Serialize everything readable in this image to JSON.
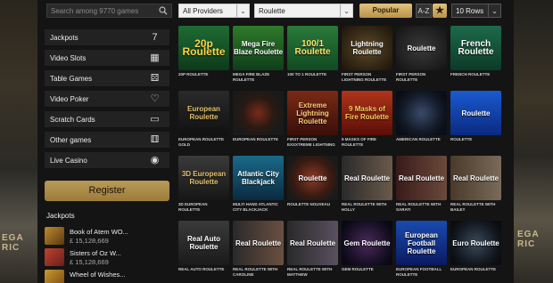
{
  "search": {
    "placeholder": "Search among 9770 games"
  },
  "filters": {
    "providers": "All Providers",
    "category": "Roulette",
    "popular_label": "Popular",
    "az_label": "A-Z",
    "rows_label": "10 Rows"
  },
  "sidebar": {
    "items": [
      {
        "label": "Jackpots",
        "icon": "seven-icon"
      },
      {
        "label": "Video Slots",
        "icon": "slot-machine-icon"
      },
      {
        "label": "Table Games",
        "icon": "dice-icon"
      },
      {
        "label": "Video Poker",
        "icon": "card-icon"
      },
      {
        "label": "Scratch Cards",
        "icon": "scratch-card-icon"
      },
      {
        "label": "Other games",
        "icon": "dice-icon"
      },
      {
        "label": "Live Casino",
        "icon": "chips-icon"
      }
    ],
    "register_label": "Register",
    "jackpots_title": "Jackpots",
    "jackpots": [
      {
        "name": "Book of Atem WO...",
        "amount": "£ 15,128,669"
      },
      {
        "name": "Sisters of Oz W...",
        "amount": "£ 15,128,669"
      },
      {
        "name": "Wheel of Wishes...",
        "amount": ""
      }
    ]
  },
  "games": [
    {
      "art": "20p Roulette",
      "caption": "20P ROULETTE"
    },
    {
      "art": "Mega Fire Blaze Roulette",
      "caption": "MEGA FIRE BLAZE ROULETTE"
    },
    {
      "art": "100/1 Roulette",
      "caption": "100 TO 1 ROULETTE"
    },
    {
      "art": "Lightning Roulette",
      "caption": "FIRST PERSON LIGHTNING ROULETTE"
    },
    {
      "art": "Roulette",
      "caption": "FIRST PERSON ROULETTE"
    },
    {
      "art": "French Roulette",
      "caption": "FRENCH ROULETTE"
    },
    {
      "art": "European Roulette",
      "caption": "EUROPEAN ROULETTE GOLD"
    },
    {
      "art": "",
      "caption": "EUROPEAN ROULETTE"
    },
    {
      "art": "Extreme Lightning Roulette",
      "caption": "FIRST PERSON EXXXTREME LIGHTNING ROULETTE"
    },
    {
      "art": "9 Masks of Fire Roulette",
      "caption": "9 MASKS OF FIRE ROULETTE"
    },
    {
      "art": "",
      "caption": "AMERICAN ROULETTE"
    },
    {
      "art": "Roulette",
      "caption": "ROULETTE"
    },
    {
      "art": "3D European Roulette",
      "caption": "3D EUROPEAN ROULETTE"
    },
    {
      "art": "Atlantic City Blackjack",
      "caption": "MULTI HAND ATLANTIC CITY BLACKJACK"
    },
    {
      "art": "Roulette",
      "caption": "ROULETTE NOUVEAU"
    },
    {
      "art": "Real Roulette",
      "caption": "REAL ROULETTE WITH HOLLY"
    },
    {
      "art": "Real Roulette",
      "caption": "REAL ROULETTE WITH SARATI"
    },
    {
      "art": "Real Roulette",
      "caption": "REAL ROULETTE WITH BAILEY"
    },
    {
      "art": "Real Auto Roulette",
      "caption": "REAL AUTO ROULETTE"
    },
    {
      "art": "Real Roulette",
      "caption": "REAL ROULETTE WITH CAROLINE"
    },
    {
      "art": "Real Roulette",
      "caption": "REAL ROULETTE WITH MATTHEW"
    },
    {
      "art": "Gem Roulette",
      "caption": "GEM ROULETTE"
    },
    {
      "art": "European Football Roulette",
      "caption": "EUROPEAN FOOTBALL ROULETTE"
    },
    {
      "art": "Euro Roulette",
      "caption": "EUROPEAN ROULETTE"
    }
  ],
  "backdrop": {
    "left_sign": "EGA RIC",
    "right_sign": "EGA RIC"
  },
  "colors": {
    "gold": "#b99a57",
    "panel": "#222222",
    "background": "#141414"
  }
}
